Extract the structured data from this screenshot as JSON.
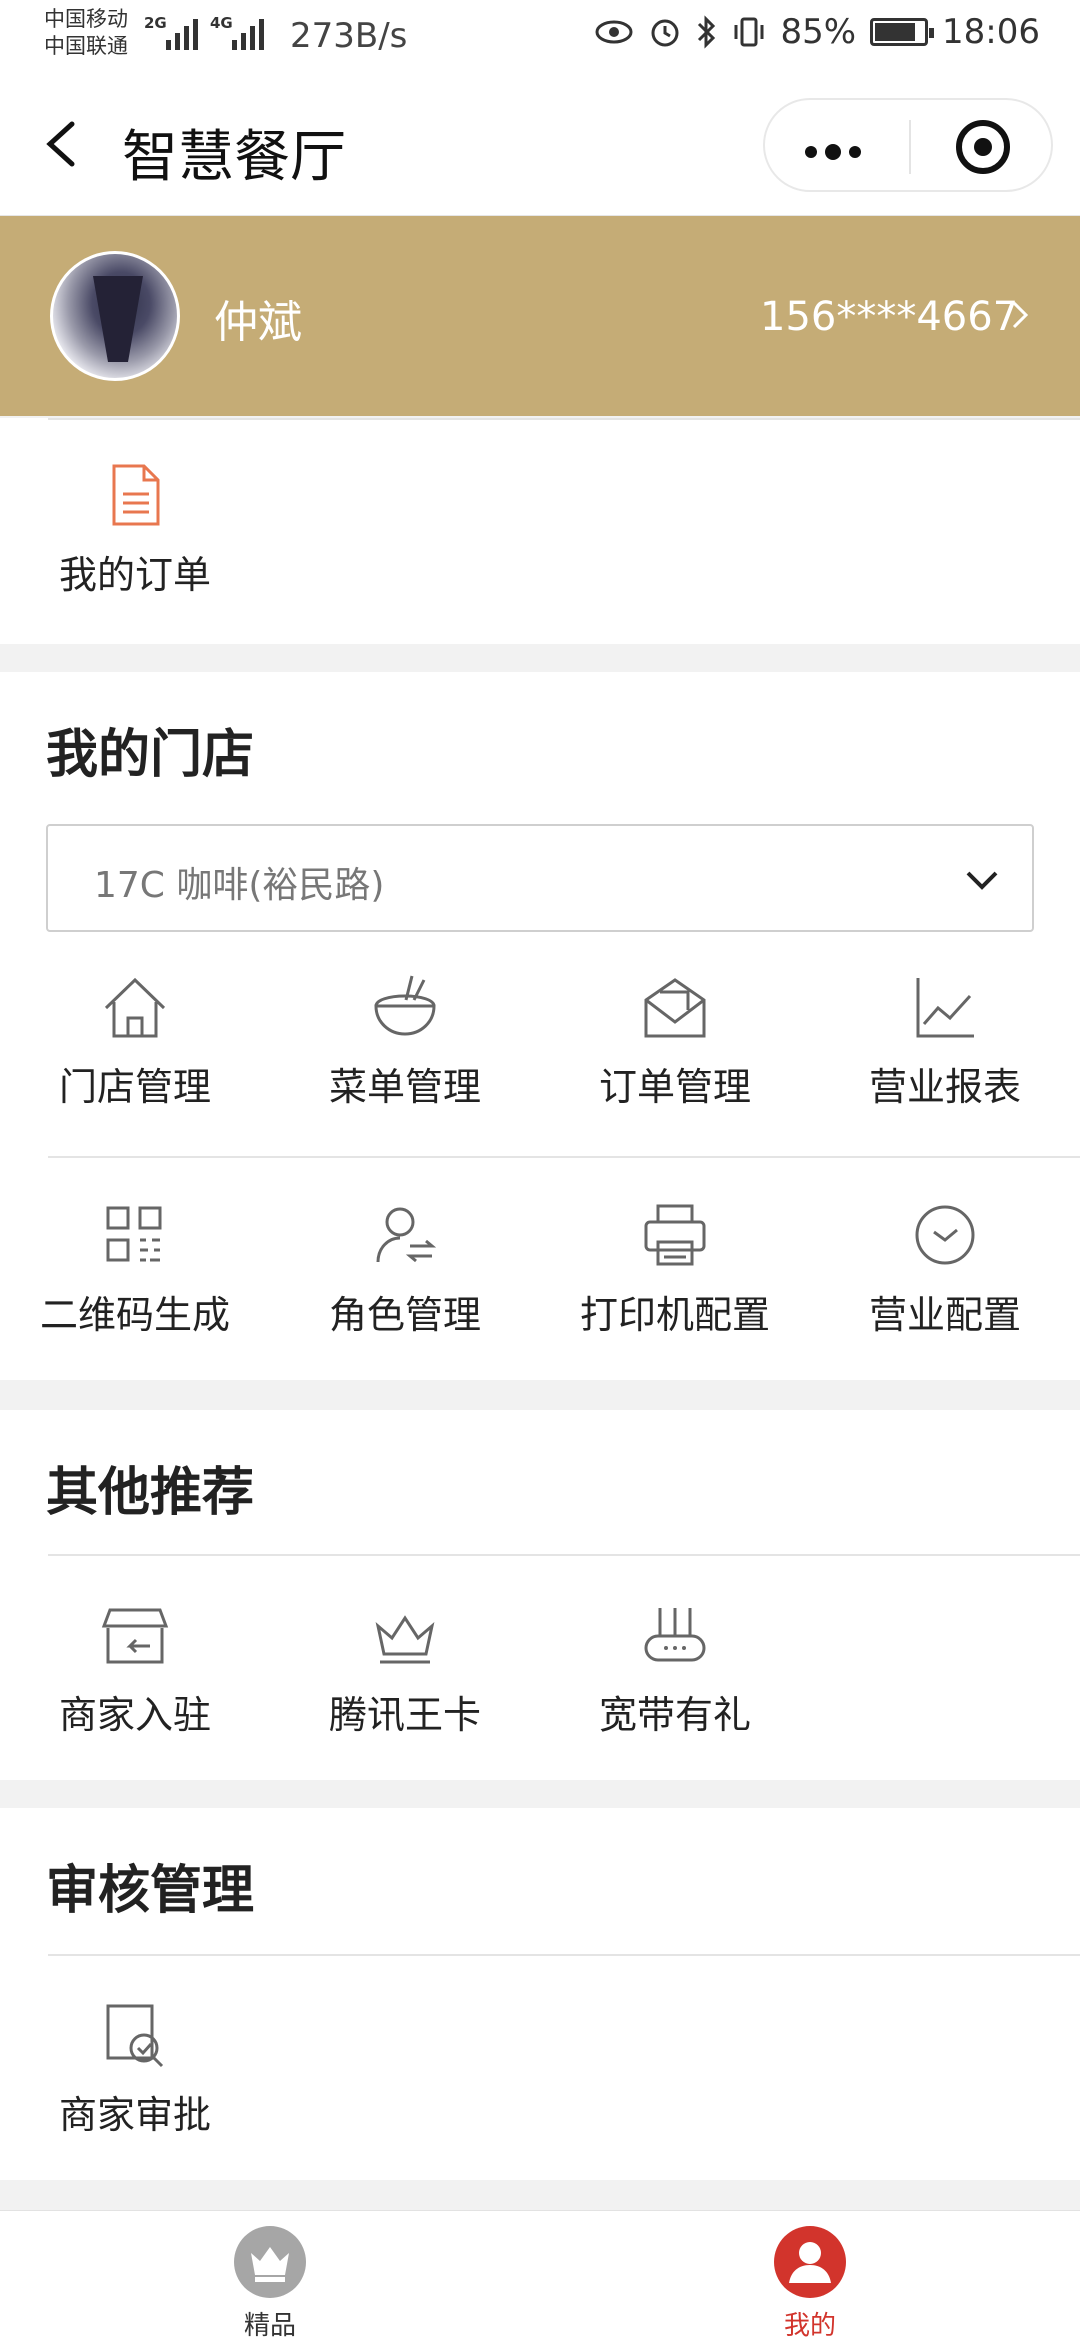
{
  "status_bar": {
    "carrier_1": "中国移动",
    "carrier_2": "中国联通",
    "net_1": "2G",
    "net_2": "4G",
    "speed": "273B/s",
    "battery": "85%",
    "time": "18:06"
  },
  "nav": {
    "title": "智慧餐厅"
  },
  "profile": {
    "name": "仲斌",
    "phone": "156****4667"
  },
  "orders": {
    "label": "我的订单"
  },
  "my_store": {
    "title": "我的门店",
    "selected_store": "17C 咖啡(裕民路)",
    "row1": [
      {
        "label": "门店管理",
        "icon": "home-icon"
      },
      {
        "label": "菜单管理",
        "icon": "bowl-icon"
      },
      {
        "label": "订单管理",
        "icon": "envelope-icon"
      },
      {
        "label": "营业报表",
        "icon": "line-chart-icon"
      }
    ],
    "row2": [
      {
        "label": "二维码生成",
        "icon": "qr-code-icon"
      },
      {
        "label": "角色管理",
        "icon": "user-switch-icon"
      },
      {
        "label": "打印机配置",
        "icon": "printer-icon"
      },
      {
        "label": "营业配置",
        "icon": "clock-icon"
      }
    ]
  },
  "others": {
    "title": "其他推荐",
    "items": [
      {
        "label": "商家入驻",
        "icon": "storefront-icon"
      },
      {
        "label": "腾讯王卡",
        "icon": "crown-icon"
      },
      {
        "label": "宽带有礼",
        "icon": "router-icon"
      }
    ]
  },
  "review": {
    "title": "审核管理",
    "items": [
      {
        "label": "商家审批",
        "icon": "document-check-icon"
      }
    ]
  },
  "tabbar": {
    "items": [
      {
        "label": "精品",
        "icon": "crown-tab-icon",
        "color": "#333333"
      },
      {
        "label": "我的",
        "icon": "user-tab-icon",
        "color": "#d2342c"
      }
    ]
  },
  "colors": {
    "profile_bg": "#c5ac76",
    "accent": "#d2342c",
    "order_icon": "#e8774f"
  }
}
